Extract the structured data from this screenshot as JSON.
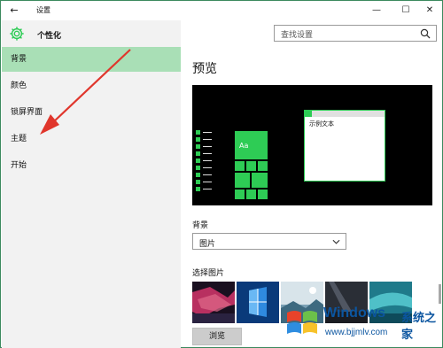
{
  "window": {
    "title": "设置",
    "back_glyph": "←",
    "minimize_glyph": "—",
    "maximize_glyph": "☐",
    "close_glyph": "✕"
  },
  "sidebar": {
    "title": "个性化",
    "items": [
      {
        "label": "背景",
        "active": true
      },
      {
        "label": "颜色",
        "active": false
      },
      {
        "label": "锁屏界面",
        "active": false
      },
      {
        "label": "主题",
        "active": false
      },
      {
        "label": "开始",
        "active": false
      }
    ]
  },
  "search": {
    "placeholder": "查找设置"
  },
  "main": {
    "section_title": "预览",
    "preview": {
      "tile_label": "Aa",
      "sample_text": "示例文本"
    },
    "background_label": "背景",
    "background_value": "图片",
    "choose_picture_label": "选择图片",
    "browse_label": "浏览",
    "thumbnails": [
      {
        "name": "wallpaper-1",
        "colors": [
          "#1a1020",
          "#b83060",
          "#2a2240"
        ]
      },
      {
        "name": "wallpaper-2",
        "colors": [
          "#0a3a7a",
          "#2f8ae0",
          "#ffffff"
        ]
      },
      {
        "name": "wallpaper-3",
        "colors": [
          "#d8e4ea",
          "#7aa0b4",
          "#3e6a80"
        ]
      },
      {
        "name": "wallpaper-4",
        "colors": [
          "#2a2e36",
          "#6a7280",
          "#1a1c22"
        ]
      },
      {
        "name": "wallpaper-5",
        "colors": [
          "#1f7a8a",
          "#4fc0c8",
          "#0e4a5a"
        ]
      }
    ]
  },
  "colors": {
    "accent": "#2ecc55",
    "active_nav": "#a9dfb6",
    "sidebar_bg": "#f2f2f2",
    "annotation_arrow": "#e0362c"
  },
  "watermark": {
    "brand": "Windows",
    "subtitle": "系统之家",
    "url": "www.bjjmlv.com"
  }
}
